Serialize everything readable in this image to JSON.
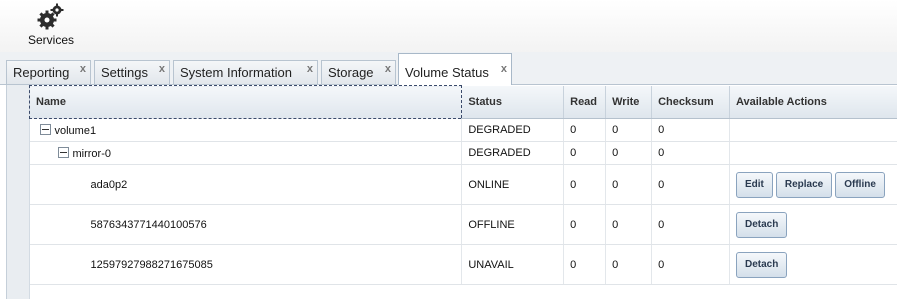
{
  "toolbar": {
    "services_label": "Services"
  },
  "tabs": [
    {
      "label": "Reporting",
      "close": "x"
    },
    {
      "label": "Settings",
      "close": "x"
    },
    {
      "label": "System Information",
      "close": "x"
    },
    {
      "label": "Storage",
      "close": "x"
    },
    {
      "label": "Volume Status",
      "close": "x",
      "active": true
    }
  ],
  "table": {
    "columns": [
      "Name",
      "Status",
      "Read",
      "Write",
      "Checksum",
      "Available Actions"
    ],
    "rows": [
      {
        "name": "volume1",
        "status": "DEGRADED",
        "read": "0",
        "write": "0",
        "checksum": "0"
      },
      {
        "name": "mirror-0",
        "status": "DEGRADED",
        "read": "0",
        "write": "0",
        "checksum": "0"
      },
      {
        "name": "ada0p2",
        "status": "ONLINE",
        "read": "0",
        "write": "0",
        "checksum": "0",
        "actions": [
          "Edit",
          "Replace",
          "Offline"
        ]
      },
      {
        "name": "5876343771440100576",
        "status": "OFFLINE",
        "read": "0",
        "write": "0",
        "checksum": "0",
        "actions": [
          "Detach"
        ]
      },
      {
        "name": "12597927988271675085",
        "status": "UNAVAIL",
        "read": "0",
        "write": "0",
        "checksum": "0",
        "actions": [
          "Detach"
        ]
      }
    ]
  }
}
